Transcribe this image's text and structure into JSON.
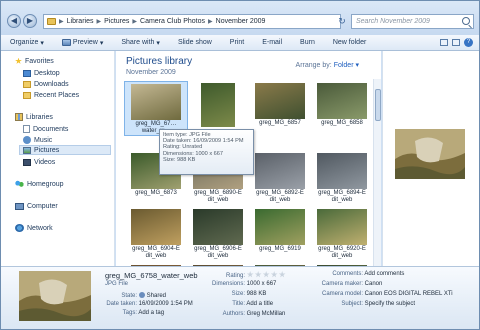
{
  "address": {
    "crumbs": [
      "Libraries",
      "Pictures",
      "Camera Club Photos",
      "November 2009"
    ],
    "search_placeholder": "Search November 2009"
  },
  "toolbar": {
    "organize": "Organize",
    "preview": "Preview",
    "share_with": "Share with",
    "slide_show": "Slide show",
    "print": "Print",
    "email": "E-mail",
    "burn": "Burn",
    "new_folder": "New folder"
  },
  "nav": {
    "favorites": "Favorites",
    "desktop": "Desktop",
    "downloads": "Downloads",
    "recent_places": "Recent Places",
    "libraries": "Libraries",
    "documents": "Documents",
    "music": "Music",
    "pictures": "Pictures",
    "videos": "Videos",
    "homegroup": "Homegroup",
    "computer": "Computer",
    "network": "Network"
  },
  "content": {
    "title": "Pictures library",
    "subtitle": "November 2009",
    "arrange_label": "Arrange by:",
    "arrange_value": "Folder"
  },
  "thumbs": [
    {
      "caption": "greg_MG_67… water_w…",
      "selected": true,
      "colors": [
        "#c4b894",
        "#6f6a3e"
      ]
    },
    {
      "caption": "",
      "selected": false,
      "colors": [
        "#3e5a2c",
        "#7d8a4a"
      ]
    },
    {
      "caption": "greg_MG_6857",
      "selected": false,
      "colors": [
        "#8a7a4a",
        "#3f5030"
      ]
    },
    {
      "caption": "greg_MG_6858",
      "selected": false,
      "colors": [
        "#4a5a3a",
        "#8a9a6a"
      ]
    },
    {
      "caption": "greg_MG_6873",
      "selected": false,
      "colors": [
        "#3a5a2a",
        "#a0a070"
      ]
    },
    {
      "caption": "greg_MG_6890-E dit_web",
      "selected": false,
      "colors": [
        "#6a6a5a",
        "#b0a080"
      ]
    },
    {
      "caption": "greg_MG_6892-E dit_web",
      "selected": false,
      "colors": [
        "#5a6068",
        "#9aa0a8"
      ]
    },
    {
      "caption": "greg_MG_6894-E dit_web",
      "selected": false,
      "colors": [
        "#505860",
        "#9098a0"
      ]
    },
    {
      "caption": "greg_MG_6904-E dit_web",
      "selected": false,
      "colors": [
        "#6a5a30",
        "#c0a060"
      ]
    },
    {
      "caption": "greg_MG_6906-E dit_web",
      "selected": false,
      "colors": [
        "#2a3a2a",
        "#606a50"
      ]
    },
    {
      "caption": "greg_MG_6919",
      "selected": false,
      "colors": [
        "#3a6a30",
        "#a0a060"
      ]
    },
    {
      "caption": "greg_MG_6920-E dit_web",
      "selected": false,
      "colors": [
        "#4a6a3a",
        "#c0b070"
      ]
    },
    {
      "caption": "",
      "selected": false,
      "colors": [
        "#6a5030",
        "#a07040"
      ]
    },
    {
      "caption": "",
      "selected": false,
      "colors": [
        "#5a4a30",
        "#9a7a50"
      ]
    },
    {
      "caption": "",
      "selected": false,
      "colors": [
        "#4a5a3a",
        "#8a6a40"
      ]
    },
    {
      "caption": "",
      "selected": false,
      "colors": [
        "#3a4a30",
        "#7a8a50"
      ]
    }
  ],
  "tooltip": {
    "line1": "Item type: JPG File",
    "line2": "Date taken: 16/09/2009 1:54 PM",
    "line3": "Rating: Unrated",
    "line4": "Dimensions: 1000 x 667",
    "line5": "Size: 988 KB"
  },
  "details": {
    "filename": "greg_MG_6758_water_web",
    "filetype": "JPG File",
    "state_label": "State:",
    "state_value": "Shared",
    "date_label": "Date taken:",
    "date_value": "16/09/2009 1:54 PM",
    "tags_label": "Tags:",
    "tags_value": "Add a tag",
    "rating_label": "Rating:",
    "dimensions_label": "Dimensions:",
    "dimensions_value": "1000 x 667",
    "size_label": "Size:",
    "size_value": "988 KB",
    "title_label": "Title:",
    "title_value": "Add a title",
    "authors_label": "Authors:",
    "authors_value": "Greg McMillan",
    "comments_label": "Comments:",
    "comments_value": "Add comments",
    "maker_label": "Camera maker:",
    "maker_value": "Canon",
    "model_label": "Camera model:",
    "model_value": "Canon EOS DIGITAL REBEL XTi",
    "subject_label": "Subject:",
    "subject_value": "Specify the subject"
  }
}
